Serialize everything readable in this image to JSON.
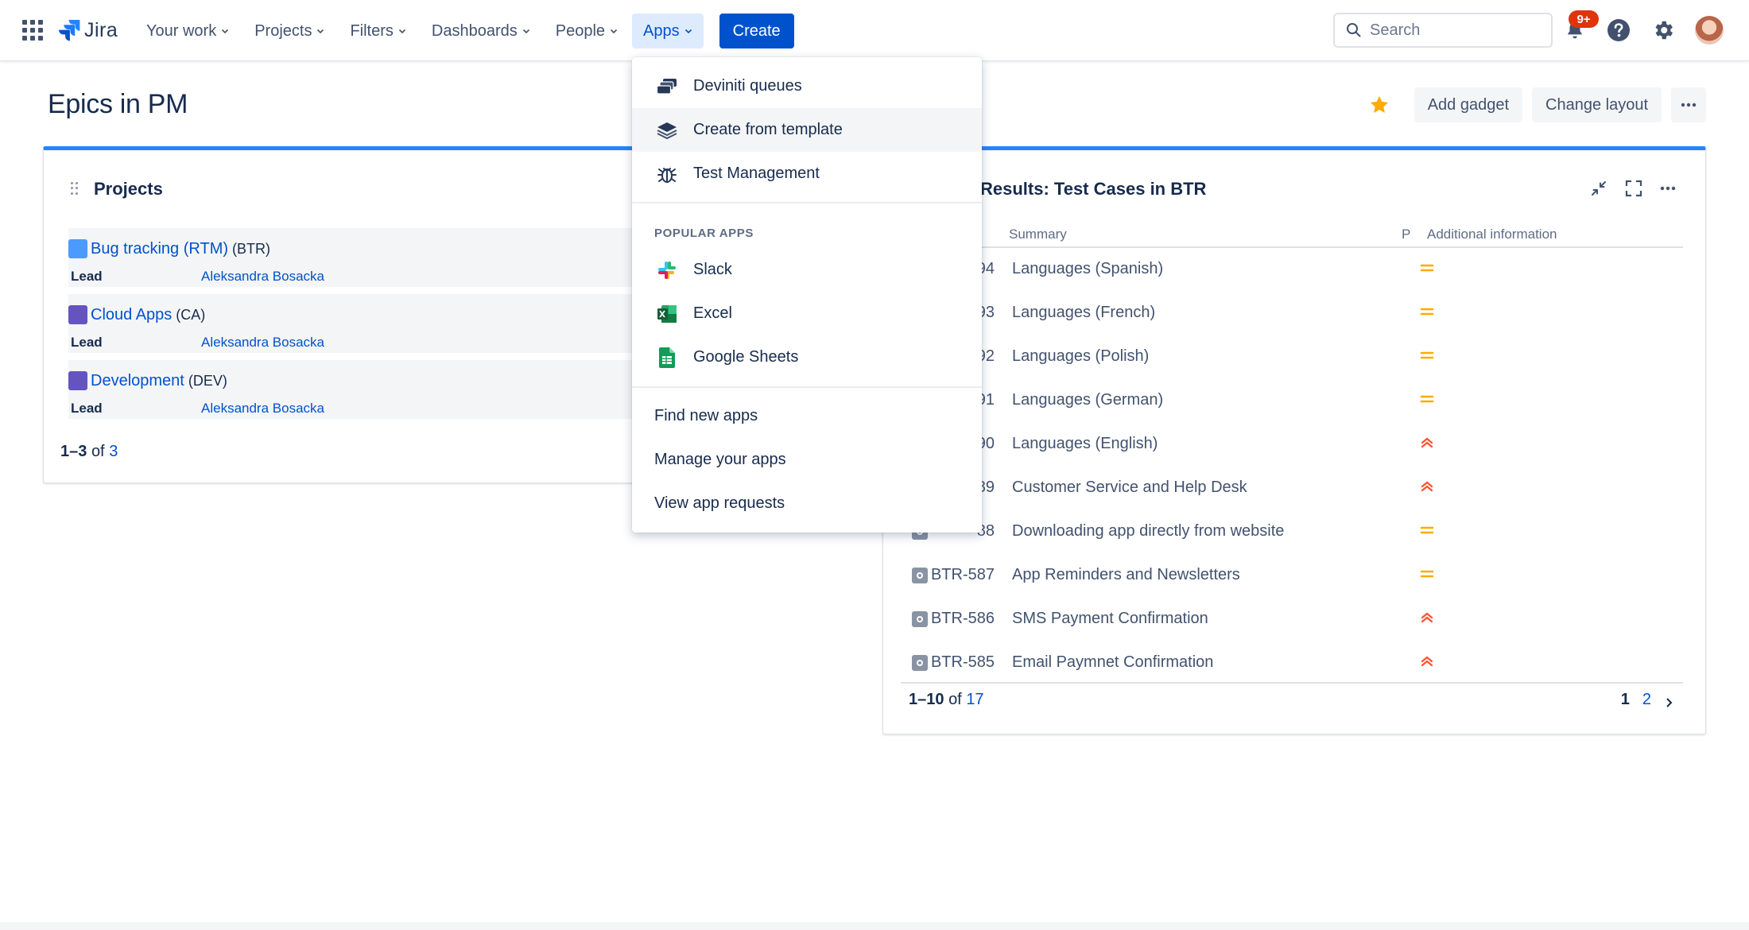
{
  "nav": {
    "logo_text": "Jira",
    "items": [
      {
        "label": "Your work"
      },
      {
        "label": "Projects"
      },
      {
        "label": "Filters"
      },
      {
        "label": "Dashboards"
      },
      {
        "label": "People"
      },
      {
        "label": "Apps"
      }
    ],
    "create_label": "Create",
    "search_placeholder": "Search",
    "notifications_badge": "9+"
  },
  "page": {
    "title": "Epics in PM",
    "add_gadget_label": "Add gadget",
    "change_layout_label": "Change layout"
  },
  "projects_gadget": {
    "title": "Projects",
    "rows": [
      {
        "name": "Bug tracking (RTM)",
        "key": "(BTR)",
        "lead_label": "Lead",
        "lead": "Aleksandra Bosacka",
        "icon_color": "#4C9AFF"
      },
      {
        "name": "Cloud Apps",
        "key": "(CA)",
        "lead_label": "Lead",
        "lead": "Aleksandra Bosacka",
        "icon_color": "#6554C0"
      },
      {
        "name": "Development",
        "key": "(DEV)",
        "lead_label": "Lead",
        "lead": "Aleksandra Bosacka",
        "icon_color": "#6554C0"
      }
    ],
    "pager": {
      "range": "1–3",
      "of": "of",
      "total": "3"
    }
  },
  "results_gadget": {
    "title": "Results: Test Cases in BTR",
    "columns": {
      "summary": "Summary",
      "priority": "P",
      "additional": "Additional information"
    },
    "rows": [
      {
        "key": "94",
        "summary": "Languages (Spanish)",
        "priority": "medium"
      },
      {
        "key": "93",
        "summary": "Languages (French)",
        "priority": "medium"
      },
      {
        "key": "92",
        "summary": "Languages (Polish)",
        "priority": "medium"
      },
      {
        "key": "91",
        "summary": "Languages (German)",
        "priority": "medium"
      },
      {
        "key": "90",
        "summary": "Languages (English)",
        "priority": "high"
      },
      {
        "key": "89",
        "summary": "Customer Service and Help Desk",
        "priority": "high"
      },
      {
        "key": "88",
        "summary": "Downloading app directly from website",
        "priority": "medium"
      },
      {
        "key": "BTR-587",
        "summary": "App Reminders and Newsletters",
        "priority": "medium"
      },
      {
        "key": "BTR-586",
        "summary": "SMS Payment Confirmation",
        "priority": "high"
      },
      {
        "key": "BTR-585",
        "summary": "Email Paymnet Confirmation",
        "priority": "high"
      }
    ],
    "pager": {
      "range": "1–10",
      "of": "of",
      "total": "17"
    },
    "pages": {
      "current": "1",
      "next": "2"
    }
  },
  "apps_menu": {
    "items": [
      {
        "label": "Deviniti queues",
        "icon": "queues-icon"
      },
      {
        "label": "Create from template",
        "icon": "layers-icon"
      },
      {
        "label": "Test Management",
        "icon": "bug-icon"
      }
    ],
    "popular_heading": "POPULAR APPS",
    "popular": [
      {
        "label": "Slack",
        "icon": "slack-icon"
      },
      {
        "label": "Excel",
        "icon": "excel-icon"
      },
      {
        "label": "Google Sheets",
        "icon": "google-sheets-icon"
      }
    ],
    "links": [
      {
        "label": "Find new apps"
      },
      {
        "label": "Manage your apps"
      },
      {
        "label": "View app requests"
      }
    ]
  },
  "colors": {
    "primary": "#0052CC",
    "accent_border": "#2684FF",
    "priority_medium": "#FFAB00",
    "priority_high": "#FF5630"
  }
}
